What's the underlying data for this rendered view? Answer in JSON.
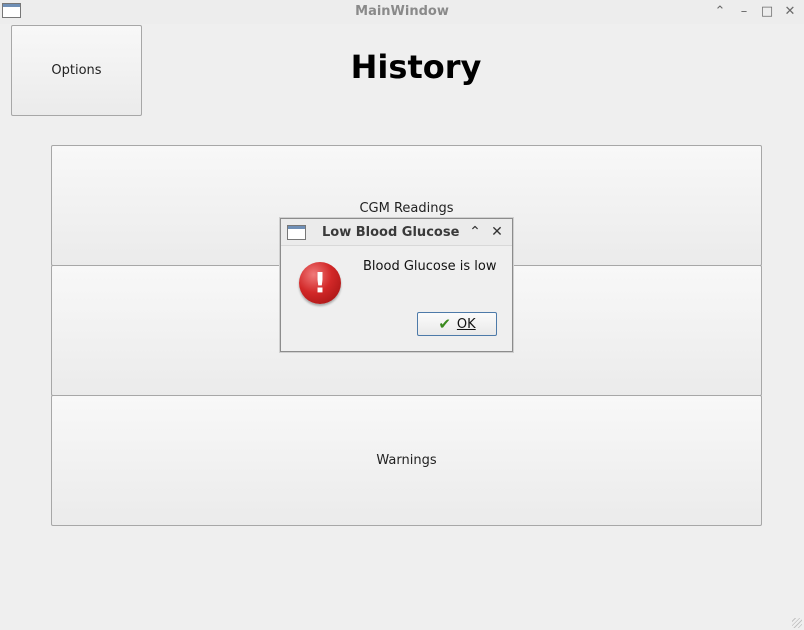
{
  "titlebar": {
    "title": "MainWindow"
  },
  "toolbar": {
    "options_label": "Options"
  },
  "page": {
    "title": "History"
  },
  "sections": [
    {
      "label": "CGM Readings"
    },
    {
      "label": ""
    },
    {
      "label": "Warnings"
    }
  ],
  "dialog": {
    "title": "Low Blood Glucose",
    "message": "Blood Glucose is low",
    "ok_label": "OK"
  },
  "colors": {
    "error": "#d22828",
    "accent": "#4d7aa9"
  }
}
